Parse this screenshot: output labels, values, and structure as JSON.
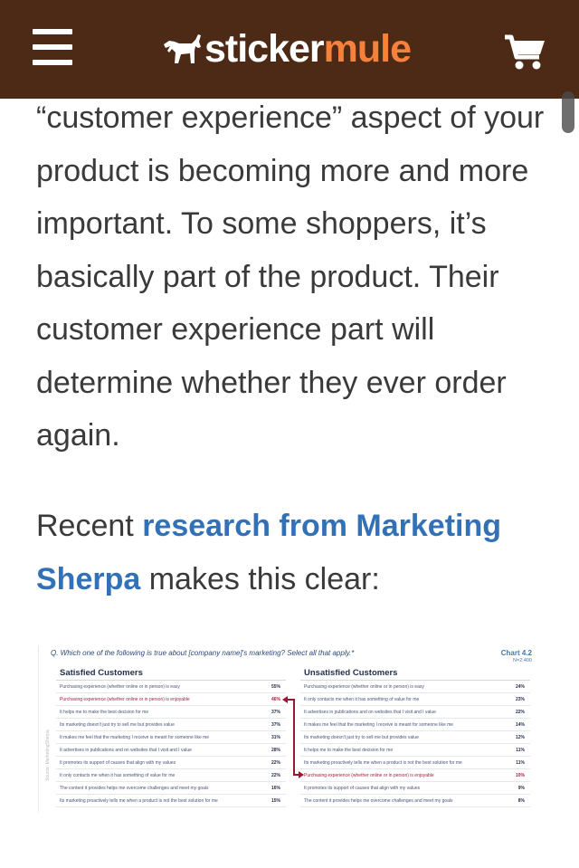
{
  "header": {
    "logo_part1": "sticker",
    "logo_part2": "mule",
    "brand_color": "#4d2a15",
    "accent_color": "#f6813c",
    "icons": [
      "menu-icon",
      "mule-logo-icon",
      "cart-icon"
    ]
  },
  "article": {
    "paragraph1": "“customer experience” aspect of your product is becoming more and more important. To some shoppers, it’s basically part of the product. Their customer experience part will determine whether they ever order again.",
    "p2_before": "Recent ",
    "p2_link": "research from Marketing Sherpa",
    "p2_after": " makes this clear:",
    "link_color": "#3371b7"
  },
  "chart": {
    "question": "Q. Which one of the following is true about [company name]'s marketing? Select all that apply.*",
    "chart_label": "Chart 4.2",
    "sample": "N=2,400",
    "source": "Source: MarketingSherpa",
    "satisfied": {
      "title": "Satisfied Customers",
      "rows": [
        {
          "label": "Purchasing experience (whether online or in person) is easy",
          "value": "55%"
        },
        {
          "label": "Purchasing experience (whether online or in person) is enjoyable",
          "value": "46%"
        },
        {
          "label": "It helps me to make the best decision for me",
          "value": "37%"
        },
        {
          "label": "Its marketing doesn't just try to sell me but provides value",
          "value": "37%"
        },
        {
          "label": "It makes me feel that the marketing I receive is meant for someone like me",
          "value": "31%"
        },
        {
          "label": "It advertises in publications and on websites that I visit and I value",
          "value": "28%"
        },
        {
          "label": "It promotes its support of causes that align with my values",
          "value": "22%"
        },
        {
          "label": "It only contacts me when it has something of value for me",
          "value": "22%"
        },
        {
          "label": "The content it provides helps me overcome challenges and meet my goals",
          "value": "16%"
        },
        {
          "label": "Its marketing proactively tells me when a product is not the best solution for me",
          "value": "15%"
        }
      ]
    },
    "unsatisfied": {
      "title": "Unsatisfied Customers",
      "rows": [
        {
          "label": "Purchasing experience (whether online or in person) is easy",
          "value": "24%"
        },
        {
          "label": "It only contacts me when it has something of value for me",
          "value": "23%"
        },
        {
          "label": "It advertises in publications and on websites that I visit and I value",
          "value": "22%"
        },
        {
          "label": "It makes me feel that the marketing I receive is meant for someone like me",
          "value": "14%"
        },
        {
          "label": "Its marketing doesn't just try to sell me but provides value",
          "value": "12%"
        },
        {
          "label": "It helps me to make the best decision for me",
          "value": "11%"
        },
        {
          "label": "Its marketing proactively tells me when a product is not the best solution for me",
          "value": "11%"
        },
        {
          "label": "Purchasing experience (whether online or in person) is enjoyable",
          "value": "10%"
        },
        {
          "label": "It promotes its support of causes that align with my values",
          "value": "9%"
        },
        {
          "label": "The content it provides helps me overcome challenges and meet my goals",
          "value": "8%"
        }
      ]
    }
  }
}
